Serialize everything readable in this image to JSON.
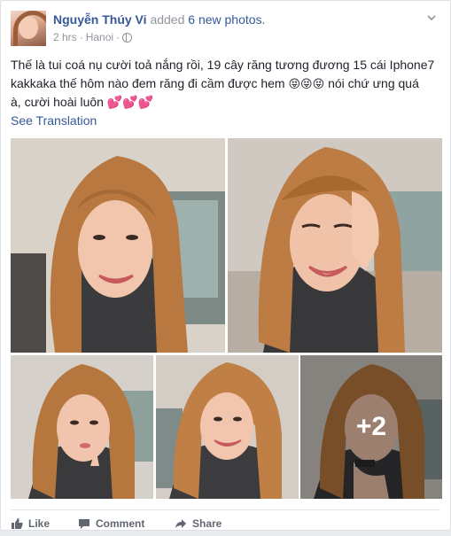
{
  "post": {
    "author": "Nguyễn Thúy Vi",
    "action_text": "added",
    "photo_count_text": "6 new photos.",
    "time": "2 hrs",
    "location": "Hanoi",
    "separator": "·",
    "body_line1": "Thế là tui coá nụ cười toả nắng rồi, 19 cây răng tương đương 15 cái Iphone7",
    "body_line2": "kakkaka thế hôm nào đem răng đi cầm được hem",
    "body_line2_tail": "nói chứ ưng quá",
    "body_line3": "à, cười hoài luôn",
    "laugh_emoji": "😝",
    "heart_emoji": "💕",
    "see_translation": "See Translation",
    "more_photos": "+2"
  },
  "actions": {
    "like": "Like",
    "comment": "Comment",
    "share": "Share"
  },
  "icons": {
    "avatar": "avatar-icon",
    "privacy": "globe-icon",
    "menu": "chevron-down-icon",
    "like": "thumbs-up-icon",
    "comment": "speech-bubble-icon",
    "share": "share-arrow-icon"
  },
  "colors": {
    "link": "#365899",
    "text": "#1d2129",
    "muted": "#90949c",
    "action": "#606770"
  }
}
